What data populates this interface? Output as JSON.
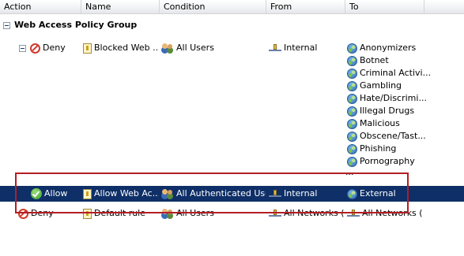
{
  "columns": [
    "Action",
    "Name",
    "Condition",
    "From",
    "To"
  ],
  "group": {
    "title": "Web Access Policy Group"
  },
  "rules": [
    {
      "action": "Deny",
      "name": "Blocked Web ...",
      "condition": "All Users",
      "from": "Internal",
      "to": [
        "Anonymizers",
        "Botnet",
        "Criminal Activi...",
        "Gambling",
        "Hate/Discrimi...",
        "Illegal Drugs",
        "Malicious",
        "Obscene/Tast...",
        "Phishing",
        "Pornography"
      ],
      "to_more": "..."
    },
    {
      "action": "Allow",
      "name": "Allow Web Ac...",
      "condition": "All Authenticated Users",
      "from": "Internal",
      "to": "External",
      "selected": true
    },
    {
      "action": "Deny",
      "name": "Default rule",
      "condition": "All Users",
      "from": "All Networks (...",
      "to": "All Networks (..."
    }
  ],
  "colors": {
    "selection": "#0e2f67",
    "highlight_box": "#b41e24",
    "deny": "#d03a2a",
    "allow": "#2f9a2a"
  }
}
